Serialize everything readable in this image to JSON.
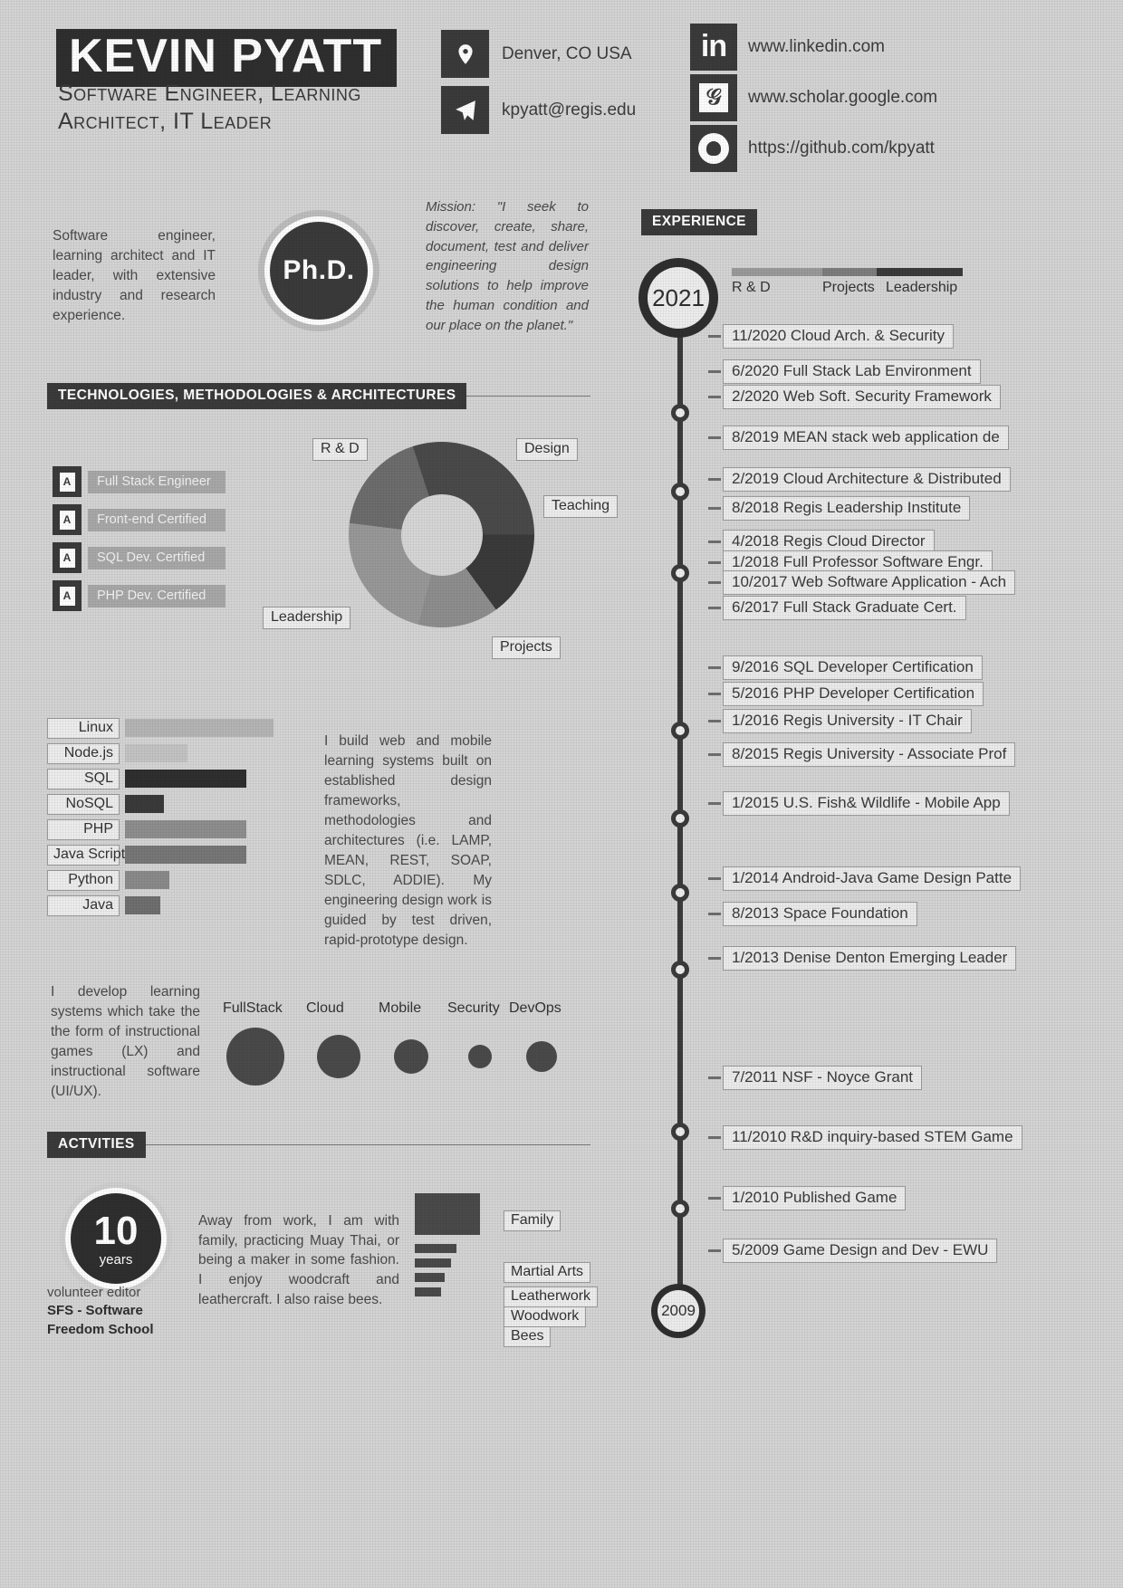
{
  "header": {
    "name": "KEVIN PYATT",
    "subtitle": "Software Engineer, Learning Architect, IT Leader",
    "contacts": [
      {
        "icon": "location-pin-icon",
        "text": "Denver, CO USA"
      },
      {
        "icon": "paper-plane-icon",
        "text": "kpyatt@regis.edu"
      }
    ],
    "links": [
      {
        "icon": "linkedin-icon",
        "glyph": "in",
        "text": "www.linkedin.com"
      },
      {
        "icon": "google-scholar-icon",
        "glyph": "G",
        "text": "www.scholar.google.com"
      },
      {
        "icon": "github-icon",
        "glyph": "gh",
        "text": "https://github.com/kpyatt"
      }
    ]
  },
  "profile": {
    "summary": "Software engineer, learning architect and IT leader, with extensive industry and research experience.",
    "degree_badge": "Ph.D.",
    "mission": "Mission: \"I seek to discover, create, share, document, test and deliver engineering design solutions to help improve the human condition and our place on the planet.\""
  },
  "sections": {
    "tech": "TECHNOLOGIES, METHODOLOGIES & ARCHITECTURES",
    "activities": "ACTVITIES",
    "experience": "EXPERIENCE"
  },
  "certifications": [
    {
      "icon": "certificate-icon",
      "label": "Full Stack Engineer"
    },
    {
      "icon": "certificate-icon",
      "label": "Front-end Certified"
    },
    {
      "icon": "certificate-icon",
      "label": "SQL Dev. Certified"
    },
    {
      "icon": "certificate-icon",
      "label": "PHP Dev. Certified"
    }
  ],
  "build_text": "I build web and mobile learning systems built on established design frameworks, methodologies and architectures (i.e. LAMP, MEAN, REST, SOAP, SDLC, ADDIE). My engineering design work is guided by test driven, rapid-prototype design.",
  "learning_text": "I develop learning systems which take the the form of instructional games (LX) and instructional software (UI/UX).",
  "activities_text": "Away from work, I am with family, practicing Muay Thai, or being a maker in some fashion. I enjoy woodcraft and leathercraft. I also raise bees.",
  "years_badge": {
    "number": "10",
    "word": "years"
  },
  "volunteer": {
    "line1": "volunteer editor",
    "line2": "SFS - Software",
    "line3": "Freedom School"
  },
  "chart_data": [
    {
      "type": "pie",
      "title": "Effort distribution",
      "name": "effort-donut",
      "categories": [
        "R & D",
        "Design",
        "Teaching",
        "Projects",
        "Leadership"
      ],
      "values": [
        30,
        15,
        14,
        23,
        18
      ],
      "colors": [
        "#4a4a4a",
        "#3a3a3a",
        "#8e8e8e",
        "#989898",
        "#6d6d6d"
      ],
      "labels": [
        "R & D",
        "Design",
        "Teaching",
        "Projects",
        "Leadership"
      ]
    },
    {
      "type": "bar",
      "title": "Technology proficiency",
      "name": "skills-bar",
      "orientation": "horizontal",
      "categories": [
        "Linux",
        "Node.js",
        "SQL",
        "NoSQL",
        "PHP",
        "Java Script",
        "Python",
        "Java"
      ],
      "values": [
        100,
        42,
        82,
        26,
        82,
        82,
        30,
        24
      ],
      "colors": [
        "#b5b5b5",
        "#c3c3c3",
        "#2f2f2f",
        "#3a3a3a",
        "#8e8e8e",
        "#777777",
        "#8a8a8a",
        "#6f6f6f"
      ],
      "xlabel": "",
      "ylabel": "",
      "xlim": [
        0,
        100
      ]
    },
    {
      "type": "scatter",
      "title": "Domain emphasis",
      "name": "domain-bubbles",
      "categories": [
        "FullStack",
        "Cloud",
        "Mobile",
        "Security",
        "DevOps"
      ],
      "values": [
        64,
        48,
        38,
        26,
        34
      ],
      "color": "#4a4a4a"
    },
    {
      "type": "bar",
      "title": "Personal interests",
      "name": "interests-bar",
      "orientation": "horizontal",
      "categories": [
        "Family",
        "Martial Arts",
        "Leatherwork",
        "Woodwork",
        "Bees"
      ],
      "values": [
        100,
        64,
        56,
        46,
        40
      ],
      "color": "#4a4a4a"
    }
  ],
  "timeline": {
    "start_year": "2021",
    "end_year": "2009",
    "legend": [
      {
        "label": "R & D",
        "color": "#9a9a9a"
      },
      {
        "label": "Projects",
        "color": "#7d7d7d"
      },
      {
        "label": "Leadership",
        "color": "#3b3b3b"
      }
    ],
    "items": [
      {
        "date": "11/2020",
        "text": "Cloud Arch. & Security"
      },
      {
        "date": "6/2020",
        "text": "Full Stack Lab Environment"
      },
      {
        "date": "2/2020",
        "text": "Web Soft. Security Framework"
      },
      {
        "date": "8/2019",
        "text": "MEAN stack web application de"
      },
      {
        "date": "2/2019",
        "text": "Cloud Architecture & Distributed"
      },
      {
        "date": "8/2018",
        "text": "Regis Leadership Institute"
      },
      {
        "date": "4/2018",
        "text": "Regis Cloud Director"
      },
      {
        "date": "1/2018",
        "text": "Full Professor Software Engr."
      },
      {
        "date": "10/2017",
        "text": "Web Software Application - Ach"
      },
      {
        "date": "6/2017",
        "text": "Full Stack Graduate Cert."
      },
      {
        "date": "9/2016",
        "text": "SQL Developer Certification"
      },
      {
        "date": "5/2016",
        "text": "PHP Developer Certification"
      },
      {
        "date": "1/2016",
        "text": "Regis University - IT Chair"
      },
      {
        "date": "8/2015",
        "text": "Regis University - Associate Prof"
      },
      {
        "date": "1/2015",
        "text": "U.S. Fish& Wildlife - Mobile App"
      },
      {
        "date": "1/2014",
        "text": "Android-Java Game Design Patte"
      },
      {
        "date": "8/2013",
        "text": "Space Foundation"
      },
      {
        "date": "1/2013",
        "text": "Denise Denton Emerging Leader"
      },
      {
        "date": "7/2011",
        "text": "NSF - Noyce Grant"
      },
      {
        "date": "11/2010",
        "text": "R&D inquiry-based STEM Game"
      },
      {
        "date": "1/2010",
        "text": "Published Game"
      },
      {
        "date": "5/2009",
        "text": "Game Design and Dev - EWU"
      }
    ]
  }
}
